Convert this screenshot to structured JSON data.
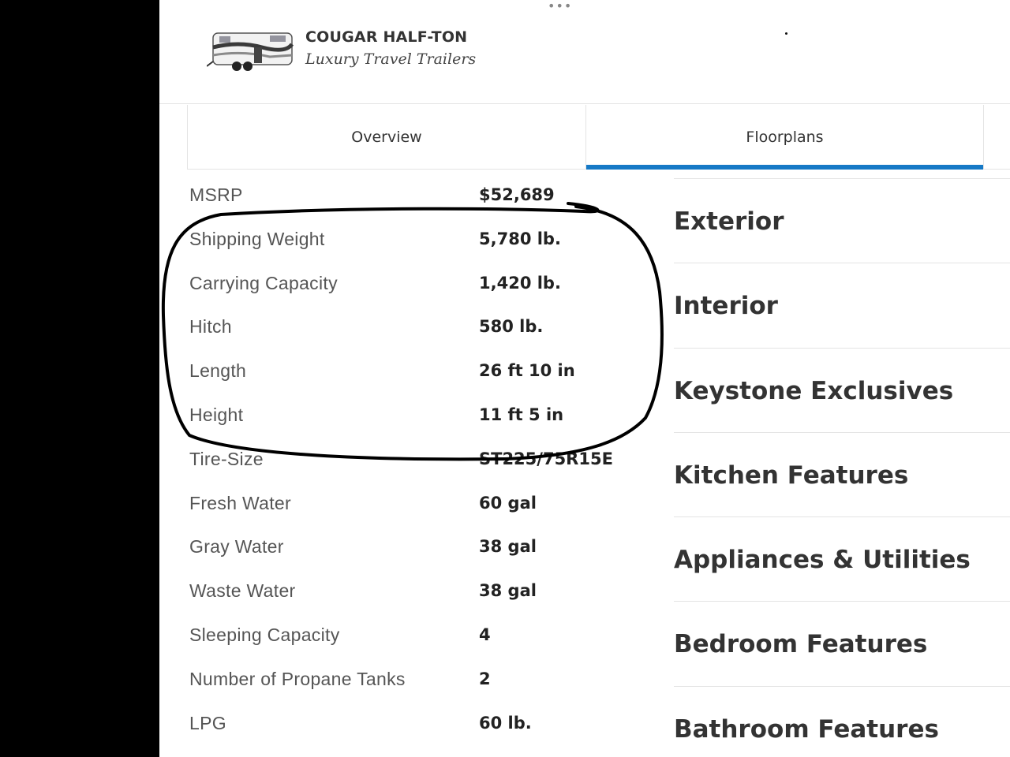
{
  "brand": {
    "name": "COUGAR HALF-TON",
    "tagline": "Luxury Travel Trailers",
    "image_icon": "travel-trailer-image"
  },
  "tabs": [
    {
      "label": "Overview",
      "active": false
    },
    {
      "label": "Floorplans",
      "active": true
    }
  ],
  "specs": [
    {
      "label": "MSRP",
      "value": "$52,689"
    },
    {
      "label": "Shipping Weight",
      "value": "5,780 lb."
    },
    {
      "label": "Carrying Capacity",
      "value": "1,420 lb."
    },
    {
      "label": "Hitch",
      "value": "580 lb."
    },
    {
      "label": "Length",
      "value": "26 ft 10 in"
    },
    {
      "label": "Height",
      "value": "11 ft 5 in"
    },
    {
      "label": "Tire-Size",
      "value": "ST225/75R15E"
    },
    {
      "label": "Fresh Water",
      "value": "60 gal"
    },
    {
      "label": "Gray Water",
      "value": "38 gal"
    },
    {
      "label": "Waste Water",
      "value": "38 gal"
    },
    {
      "label": "Sleeping Capacity",
      "value": "4"
    },
    {
      "label": "Number of Propane Tanks",
      "value": "2"
    },
    {
      "label": "LPG",
      "value": "60 lb."
    }
  ],
  "features": [
    {
      "label": "Exterior"
    },
    {
      "label": "Interior"
    },
    {
      "label": "Keystone Exclusives"
    },
    {
      "label": "Kitchen Features"
    },
    {
      "label": "Appliances & Utilities"
    },
    {
      "label": "Bedroom Features"
    },
    {
      "label": "Bathroom Features"
    }
  ],
  "colors": {
    "accent": "#1679c6",
    "annotation_ink": "#000000"
  }
}
